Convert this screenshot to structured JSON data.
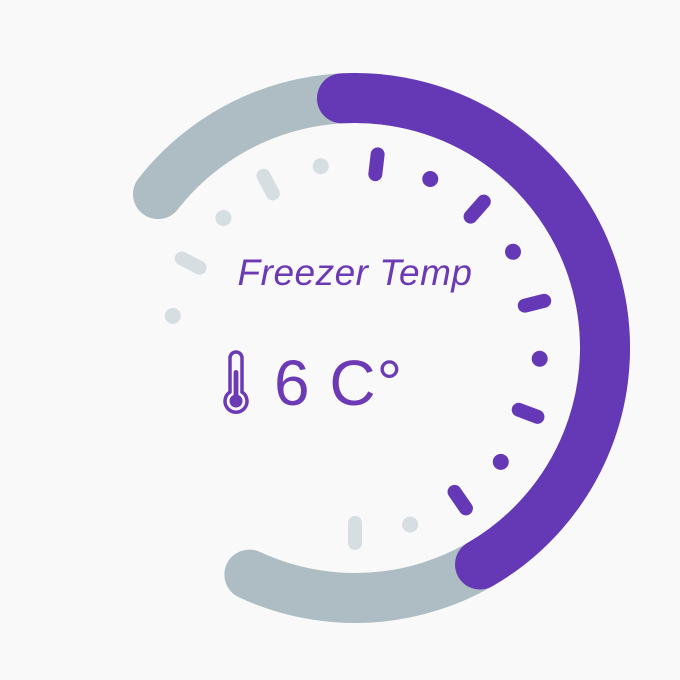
{
  "gauge": {
    "title": "Freezer Temp",
    "value_text": "6 C°",
    "fill_fraction": 0.5,
    "ticks": 16,
    "ticks_highlighted": 10,
    "colors": {
      "active": "#6539b6",
      "track": "#aebdc3",
      "tick_inactive": "#d6dee1",
      "text": "#6c3ab5",
      "background": "#f9f9f9"
    },
    "icon": "thermometer-icon"
  }
}
